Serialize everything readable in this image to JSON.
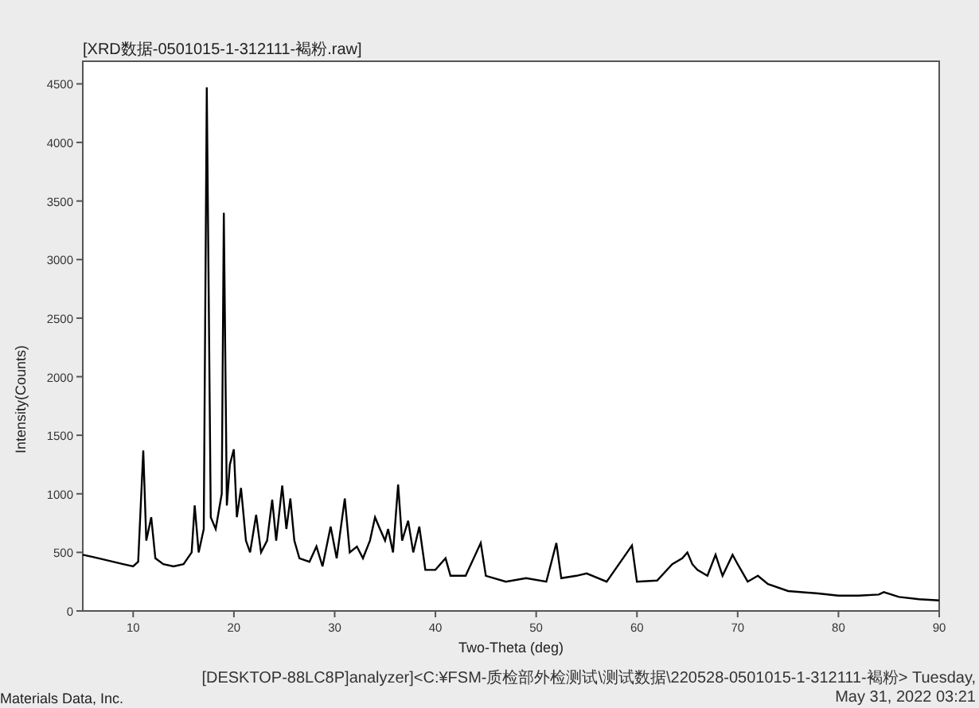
{
  "chart_title": "[XRD数据-0501015-1-312111-褐粉.raw]",
  "chart": {
    "chart_data": {
      "type": "line",
      "xlabel": "Two-Theta (deg)",
      "ylabel": "Intensity(Counts)",
      "xlim": [
        5,
        90
      ],
      "ylim": [
        0,
        4700
      ],
      "xticks": [
        10,
        20,
        30,
        40,
        50,
        60,
        70,
        80,
        90
      ],
      "yticks": [
        0,
        500,
        1000,
        1500,
        2000,
        2500,
        3000,
        3500,
        4000,
        4500
      ],
      "x": [
        5,
        6,
        7,
        8,
        9,
        10,
        10.5,
        11,
        11.3,
        11.8,
        12.2,
        13,
        14,
        15,
        15.8,
        16.1,
        16.5,
        17,
        17.3,
        17.7,
        18.2,
        18.8,
        19,
        19.3,
        19.6,
        20,
        20.3,
        20.7,
        21.2,
        21.6,
        22.2,
        22.7,
        23.3,
        23.8,
        24.2,
        24.8,
        25.2,
        25.6,
        26,
        26.5,
        27.5,
        28.2,
        28.8,
        29.6,
        30.2,
        31,
        31.5,
        32.2,
        32.8,
        33.5,
        34,
        34.5,
        35,
        35.3,
        35.8,
        36.3,
        36.7,
        37.3,
        37.8,
        38.4,
        39,
        40,
        41,
        41.5,
        43,
        44.5,
        45,
        47,
        49,
        51,
        52,
        52.5,
        54,
        55,
        57,
        59.5,
        60,
        62,
        63.5,
        64.5,
        65,
        65.5,
        66,
        67,
        67.8,
        68.5,
        69.5,
        70,
        71,
        72,
        73,
        75,
        78,
        80,
        82,
        84,
        84.5,
        86,
        88,
        90
      ],
      "series": [
        {
          "color": "#000000",
          "values": [
            480,
            460,
            440,
            420,
            400,
            380,
            420,
            1370,
            600,
            800,
            450,
            400,
            380,
            400,
            500,
            900,
            500,
            700,
            4470,
            800,
            700,
            1000,
            3400,
            900,
            1250,
            1380,
            800,
            1050,
            600,
            500,
            820,
            500,
            600,
            950,
            600,
            1070,
            700,
            960,
            600,
            450,
            420,
            550,
            380,
            720,
            450,
            960,
            500,
            550,
            450,
            600,
            800,
            700,
            600,
            700,
            500,
            1080,
            600,
            770,
            500,
            720,
            350,
            350,
            450,
            300,
            300,
            580,
            300,
            250,
            280,
            250,
            580,
            280,
            300,
            320,
            250,
            560,
            250,
            260,
            400,
            450,
            500,
            400,
            350,
            300,
            480,
            300,
            480,
            400,
            250,
            300,
            230,
            170,
            150,
            130,
            130,
            140,
            160,
            120,
            100,
            90
          ]
        }
      ]
    }
  },
  "company": "Materials Data, Inc.",
  "footer": "[DESKTOP-88LC8P]analyzer]<C:¥FSM-质检部外检测试\\测试数据\\220528-0501015-1-312111-褐粉> Tuesday, May 31, 2022 03:21"
}
